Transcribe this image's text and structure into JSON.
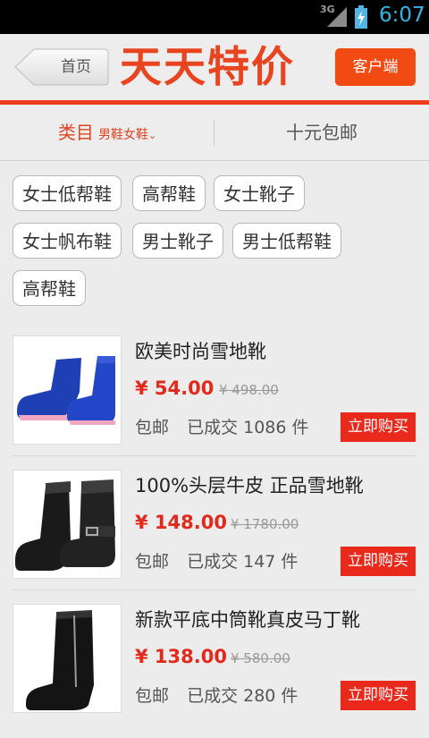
{
  "status": {
    "network": "3G",
    "time": "6:07"
  },
  "header": {
    "home_label": "首页",
    "brand": "天天特价",
    "client_label": "客户端"
  },
  "tabs": {
    "category": "类目",
    "category_sub": "男鞋女鞋",
    "chevron": "⌄",
    "free_shipping": "十元包邮"
  },
  "tags": [
    "女士低帮鞋",
    "高帮鞋",
    "女士靴子",
    "女士帆布鞋",
    "男士靴子",
    "男士低帮鞋",
    "高帮鞋"
  ],
  "products": [
    {
      "title": "欧美时尚雪地靴",
      "price": "¥ 54.00",
      "original": "¥ 498.00",
      "shipping": "包邮",
      "sold": "已成交 1086 件",
      "buy_label": "立即购买",
      "image": "blue-snow-boot"
    },
    {
      "title": "100%头层牛皮 正品雪地靴",
      "price": "¥ 148.00",
      "original": "¥ 1780.00",
      "shipping": "包邮",
      "sold": "已成交 147 件",
      "buy_label": "立即购买",
      "image": "black-buckle-boot"
    },
    {
      "title": "新款平底中筒靴真皮马丁靴",
      "price": "¥ 138.00",
      "original": "¥ 580.00",
      "shipping": "包邮",
      "sold": "已成交 280 件",
      "buy_label": "立即购买",
      "image": "black-zip-boot"
    }
  ],
  "colors": {
    "accent": "#e8441f",
    "price": "#e12a1c",
    "buy": "#e8291c",
    "status_text": "#33b5e5"
  }
}
